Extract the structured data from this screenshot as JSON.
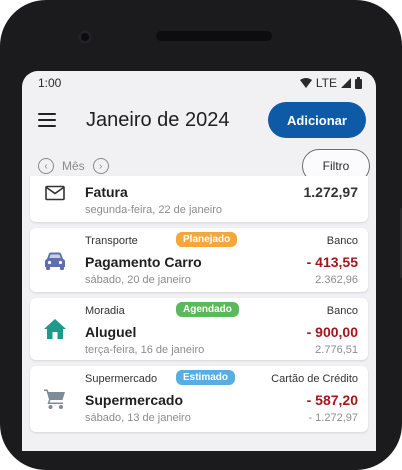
{
  "status": {
    "time": "1:00",
    "network": "LTE"
  },
  "header": {
    "title": "Janeiro de 2024",
    "add_label": "Adicionar"
  },
  "filterbar": {
    "month_label": "Mês",
    "filter_label": "Filtro"
  },
  "transactions": [
    {
      "category": "",
      "badge": "",
      "name": "Fatura",
      "date": "segunda-feira, 22 de janeiro",
      "account": "",
      "amount": "1.272,97",
      "balance": ""
    },
    {
      "category": "Transporte",
      "badge": "Planejado",
      "name": "Pagamento Carro",
      "date": "sábado, 20 de janeiro",
      "account": "Banco",
      "amount": "- 413,55",
      "balance": "2.362,96"
    },
    {
      "category": "Moradia",
      "badge": "Agendado",
      "name": "Aluguel",
      "date": "terça-feira, 16 de janeiro",
      "account": "Banco",
      "amount": "- 900,00",
      "balance": "2.776,51"
    },
    {
      "category": "Supermercado",
      "badge": "Estimado",
      "name": "Supermercado",
      "date": "sábado, 13 de janeiro",
      "account": "Cartão de Crédito",
      "amount": "- 587,20",
      "balance": "- 1.272,97"
    }
  ],
  "colors": {
    "primary": "#0f5aa6",
    "negative": "#a3161c",
    "planejado": "#f6a73b",
    "agendado": "#5cb85c",
    "estimado": "#5aade0",
    "car_icon": "#5f6fae",
    "home_icon": "#1d9a8c",
    "cart_icon": "#7e8b99"
  },
  "icons": [
    "menu-icon",
    "signal-icon",
    "battery-icon",
    "chevron-left-icon",
    "chevron-right-icon",
    "mail-icon",
    "car-icon",
    "home-icon",
    "cart-icon"
  ]
}
